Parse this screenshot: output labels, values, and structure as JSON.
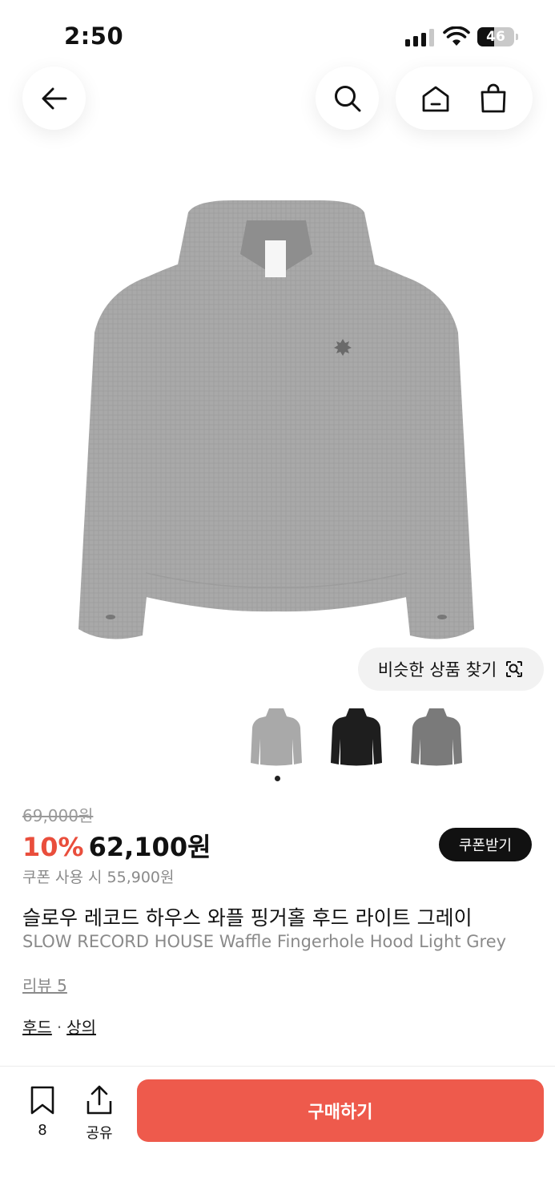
{
  "status_bar": {
    "time": "2:50",
    "battery_level": "46",
    "icons": [
      "signal-icon",
      "wifi-icon",
      "battery-icon"
    ]
  },
  "nav": {
    "icons": [
      "back-arrow-icon",
      "search-icon",
      "home-icon",
      "shopping-bag-icon"
    ]
  },
  "gallery": {
    "similar_button": "비슷한 상품 찾기",
    "similar_icon": "visual-search-icon",
    "thumbnails": [
      "light-grey",
      "black",
      "dark-grey"
    ],
    "active_index": 0
  },
  "product": {
    "original_price": "69,000원",
    "discount": "10%",
    "price": "62,100원",
    "coupon_button": "쿠폰받기",
    "coupon_price": "쿠폰 사용 시 55,900원",
    "title_ko": "슬로우 레코드 하우스 와플 핑거홀 후드 라이트 그레이",
    "title_en": "SLOW RECORD HOUSE Waffle Fingerhole Hood Light Grey",
    "review": "리뷰 5",
    "category_1": "후드",
    "category_sep": "·",
    "category_2": "상의"
  },
  "bottom_bar": {
    "bookmark_count": "8",
    "share_label": "공유",
    "buy_label": "구매하기"
  },
  "colors": {
    "accent": "#ee5a4c",
    "discount": "#e94e3c",
    "coupon_bg": "#111111",
    "hoodie_light": "#a9a9a9",
    "hoodie_black": "#1e1e1e",
    "hoodie_dark": "#7a7a7a"
  }
}
